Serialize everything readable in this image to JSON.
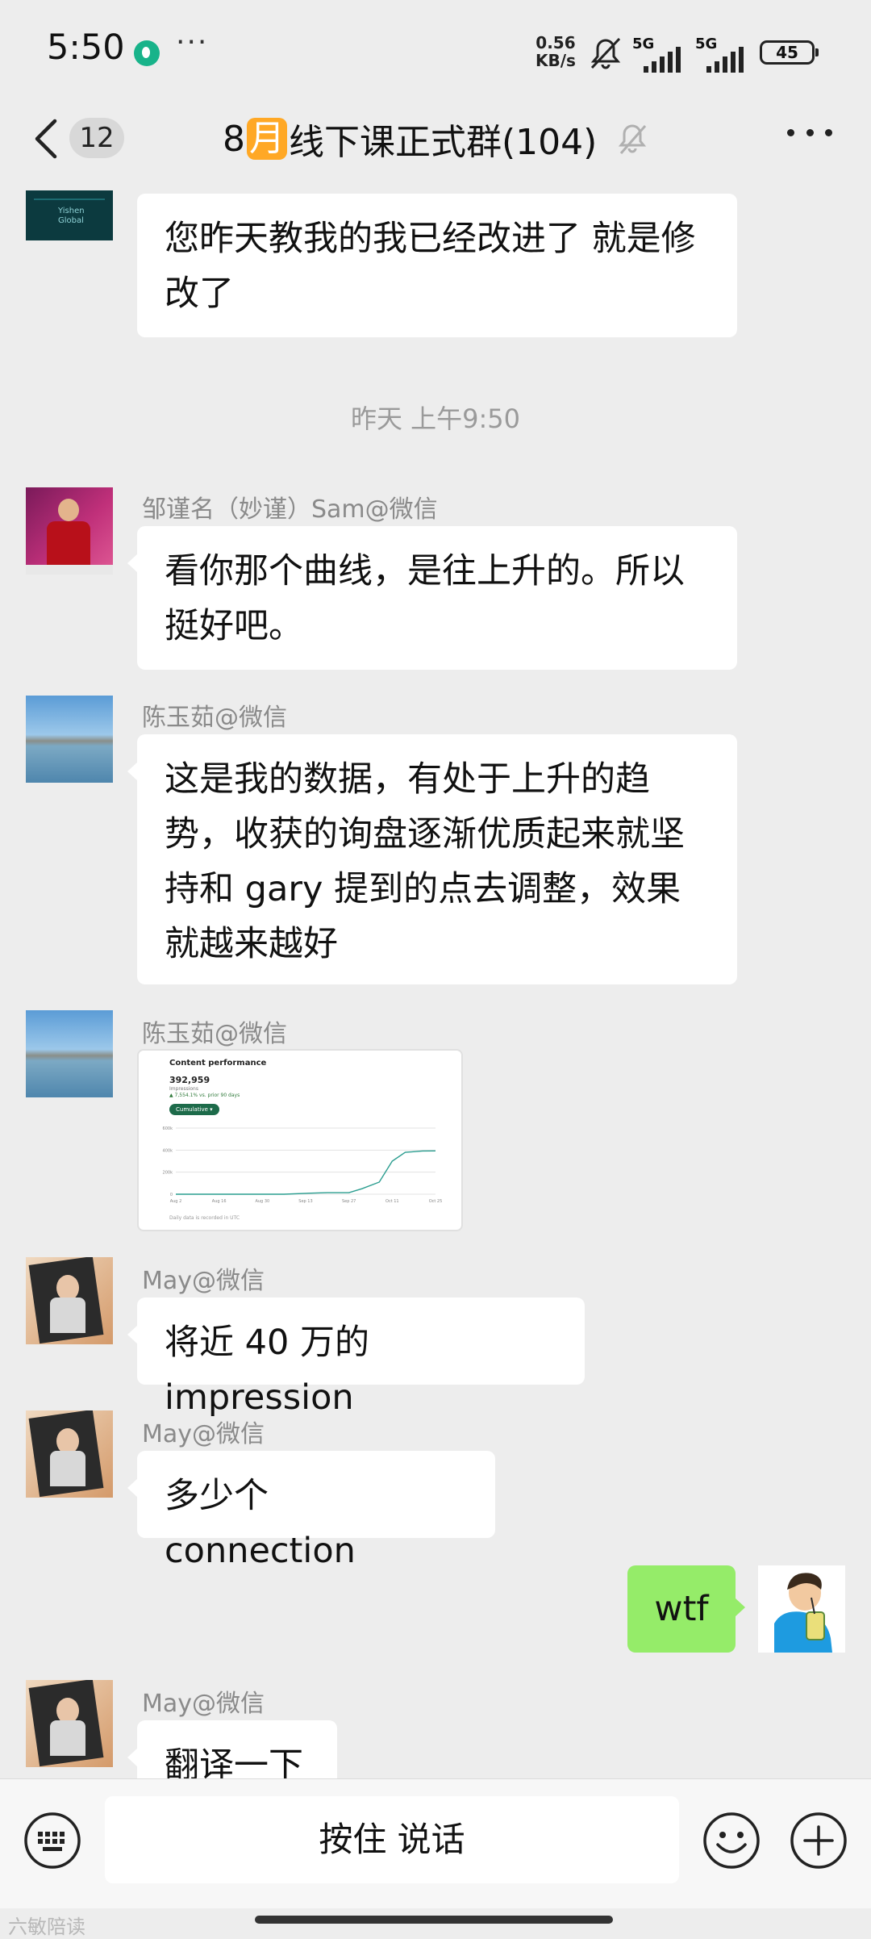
{
  "status_bar": {
    "time": "5:50",
    "more": "···",
    "net_speed_value": "0.56",
    "net_speed_unit": "KB/s",
    "sim1_label": "5G",
    "sim2_label": "5G",
    "battery": "45"
  },
  "header": {
    "unread_count": "12",
    "title_prefix": "8",
    "title_badge": "月",
    "title_rest": "线下课正式群(104)",
    "muted": true
  },
  "messages": [
    {
      "sender": "",
      "text": "您昨天教我的我已经改进了  就是修改了",
      "avatar_text": "Yishen Global"
    },
    {
      "sender": "邹谨名（妙谨）Sam@微信",
      "text": "看你那个曲线，是往上升的。所以挺好吧。"
    },
    {
      "sender": "陈玉茹@微信",
      "text": "这是我的数据，有处于上升的趋势，收获的询盘逐渐优质起来就坚持和 gary 提到的点去调整，效果就越来越好"
    },
    {
      "sender": "陈玉茹@微信",
      "image": "chart"
    },
    {
      "sender": "May@微信",
      "text": "将近 40 万的 impression"
    },
    {
      "sender": "May@微信",
      "text": "多少个 connection"
    },
    {
      "sender": "self",
      "text": "wtf"
    },
    {
      "sender": "May@微信",
      "text": "翻译一下"
    }
  ],
  "timestamp": "昨天 上午9:50",
  "chart_card": {
    "title": "Content performance",
    "total": "392,959",
    "subtitle": "Impressions",
    "change": "▲ 7,554.1% vs. prior 90 days",
    "button": "Cumulative ▾",
    "footer": "Daily data is recorded in UTC"
  },
  "chart_data": {
    "type": "line",
    "title": "Content performance",
    "x": [
      "Aug 2",
      "Aug 16",
      "Aug 30",
      "Sep 13",
      "Sep 27",
      "Oct 11",
      "Oct 25"
    ],
    "y_ticks": [
      "0",
      "200k",
      "400k",
      "600k"
    ],
    "ylim": [
      0,
      600000
    ],
    "series": [
      {
        "name": "",
        "points": [
          [
            0,
            0
          ],
          [
            0.5,
            0
          ],
          [
            1,
            0
          ],
          [
            1.5,
            0
          ],
          [
            2,
            0
          ],
          [
            2.5,
            0
          ],
          [
            3,
            8000
          ],
          [
            3.5,
            14000
          ],
          [
            4,
            14000
          ],
          [
            4.3,
            50000
          ],
          [
            4.7,
            110000
          ],
          [
            5,
            300000
          ],
          [
            5.3,
            380000
          ],
          [
            5.7,
            392000
          ],
          [
            6,
            392959
          ]
        ]
      }
    ],
    "color": "#2a9d8f",
    "grid": true
  },
  "input": {
    "hold_to_talk": "按住 说话"
  },
  "watermark": "六敏陪读"
}
